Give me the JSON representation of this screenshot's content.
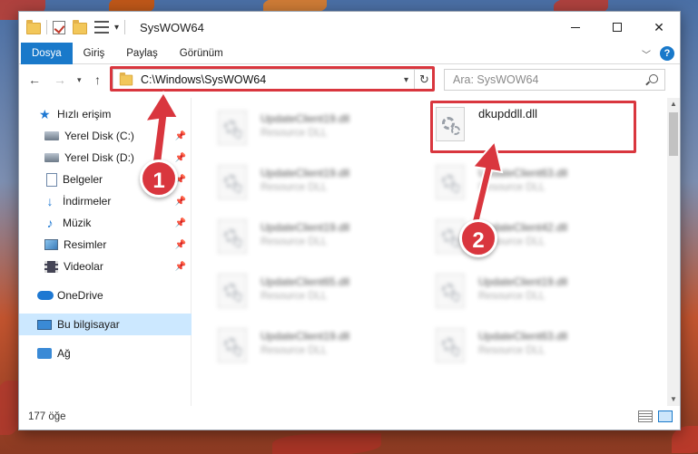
{
  "window": {
    "title": "SysWOW64",
    "caret": "▾"
  },
  "ribbon": {
    "tabs": [
      "Dosya",
      "Giriş",
      "Paylaş",
      "Görünüm"
    ]
  },
  "navbar": {
    "address": "C:\\Windows\\SysWOW64",
    "search_placeholder": "Ara: SysWOW64"
  },
  "sidebar": {
    "items": [
      {
        "label": "Hızlı erişim",
        "icon": "star-icon"
      },
      {
        "label": "Yerel Disk (C:)",
        "icon": "drive-icon",
        "pinned": true
      },
      {
        "label": "Yerel Disk (D:)",
        "icon": "drive-icon",
        "pinned": true
      },
      {
        "label": "Belgeler",
        "icon": "document-icon",
        "pinned": true
      },
      {
        "label": "İndirmeler",
        "icon": "download-icon",
        "pinned": true
      },
      {
        "label": "Müzik",
        "icon": "music-icon",
        "pinned": true
      },
      {
        "label": "Resimler",
        "icon": "pictures-icon",
        "pinned": true
      },
      {
        "label": "Videolar",
        "icon": "videos-icon",
        "pinned": true
      },
      {
        "label": "OneDrive",
        "icon": "cloud-icon"
      },
      {
        "label": "Bu bilgisayar",
        "icon": "computer-icon",
        "selected": true
      },
      {
        "label": "Ağ",
        "icon": "network-icon"
      }
    ]
  },
  "files": {
    "left_column": [
      {
        "name": "UpdateClient19.dll",
        "type": "Resource DLL"
      },
      {
        "name": "UpdateClient19.dll",
        "type": "Resource DLL"
      },
      {
        "name": "UpdateClient19.dll",
        "type": "Resource DLL"
      },
      {
        "name": "UpdateClient65.dll",
        "type": "Resource DLL"
      },
      {
        "name": "UpdateClient19.dll",
        "type": "Resource DLL"
      }
    ],
    "right_column": [
      {
        "name": "dkupddll.dll",
        "type": ""
      },
      {
        "name": "UpdateClient63.dll",
        "type": "Resource DLL"
      },
      {
        "name": "UpdateClient42.dll",
        "type": "Resource DLL"
      },
      {
        "name": "UpdateClient19.dll",
        "type": "Resource DLL"
      },
      {
        "name": "UpdateClient63.dll",
        "type": "Resource DLL"
      }
    ]
  },
  "statusbar": {
    "count": "177 öğe"
  },
  "annotations": {
    "badge1": "1",
    "badge2": "2"
  },
  "colors": {
    "accent": "#1979ca",
    "highlight": "#d9363e",
    "selection": "#cce8ff"
  }
}
